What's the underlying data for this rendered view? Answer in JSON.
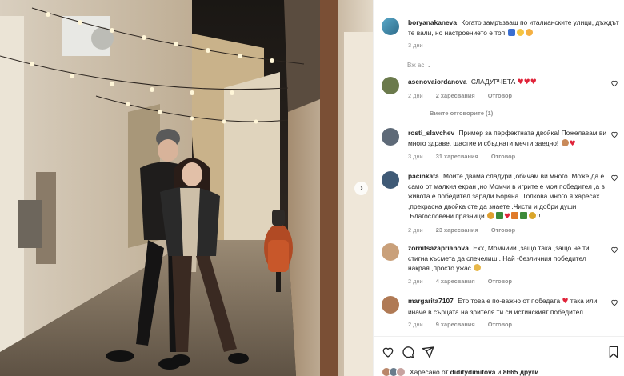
{
  "post": {
    "author": "boryanakaneva",
    "caption": "Когато замръзваш по италианските улици, дъждът те вали, но настроението е топ",
    "caption_emojis": [
      "blue-flag-emoji",
      "grin-emoji",
      "smile-hearts-emoji"
    ],
    "time": "3 дни",
    "see_translation": "Вж ас"
  },
  "comments": [
    {
      "user": "asenovaiordanova",
      "text": "СЛАДУРЧЕТА",
      "emojis": [
        "heart",
        "heart",
        "heart"
      ],
      "time": "2 дни",
      "likes": "2 харесвания",
      "reply": "Отговор",
      "view_replies": "Вижте отговорите (1)",
      "avatar_color": "#6b7a4c"
    },
    {
      "user": "rosti_slavchev",
      "text": "Пример за перфектната двойка! Пожелавам ви много здраве, щастие и сбъднати мечти заедно!",
      "emojis": [
        "face",
        "heart"
      ],
      "time": "3 дни",
      "likes": "31 харесвания",
      "reply": "Отговор",
      "avatar_color": "#5e6a78"
    },
    {
      "user": "pacinkata",
      "text": "Моите двама сладури ,обичам ви много .Може да е само от малкия екран ,но Момчи в игрите е моя победител ,а в живота е победител заради Боряна .Толкова много я харесах ,прекрасна двойка сте да знаете .Чисти и добри души .Благословени празници",
      "emojis": [
        "face",
        "tree",
        "heart",
        "gift",
        "tree",
        "bell"
      ],
      "tail": "!!",
      "time": "2 дни",
      "likes": "23 харесвания",
      "reply": "Отговор",
      "avatar_color": "#3f5a76"
    },
    {
      "user": "zornitsazaprianova",
      "text": "Ехх, Момчиии ,защо така ,защо не ти стигна късмета да спечелиш . Най -безличния победител накрая ,просто ужас",
      "emojis": [
        "face"
      ],
      "time": "2 дни",
      "likes": "4 харесвания",
      "reply": "Отговор",
      "avatar_color": "#c9a07a"
    },
    {
      "user": "margarita7107",
      "text": "Ето това е по-важно от победата",
      "emojis": [
        "heart"
      ],
      "text_after": " така или иначе в сърцата на зрителя ти си истинският победител",
      "time": "2 дни",
      "likes": "9 харесвания",
      "reply": "Отговор",
      "avatar_color": "#b07a55"
    }
  ],
  "footer": {
    "liked_prefix": "Харесано от",
    "liked_user": "diditydimitova",
    "liked_connector": "и",
    "liked_others": "8665 други"
  },
  "colors": {
    "heart": "#ed4956",
    "muted": "#8e8e8e",
    "text": "#262626",
    "border": "#efefef"
  }
}
